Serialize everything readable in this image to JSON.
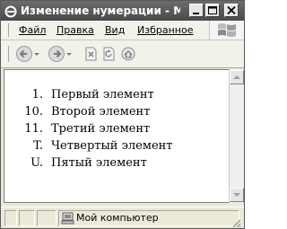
{
  "window": {
    "title": "Изменение нумерации - Microsoft Internet Explorer"
  },
  "menu": {
    "items": [
      "Файл",
      "Правка",
      "Вид",
      "Избранное"
    ]
  },
  "toolbar": {
    "buttons": [
      "back",
      "forward",
      "stop",
      "refresh",
      "home"
    ]
  },
  "page": {
    "list": [
      {
        "marker": "1.",
        "text": "Первый элемент"
      },
      {
        "marker": "10.",
        "text": "Второй элемент"
      },
      {
        "marker": "11.",
        "text": "Третий элемент"
      },
      {
        "marker": "T.",
        "text": "Четвертый элемент"
      },
      {
        "marker": "U.",
        "text": "Пятый элемент"
      }
    ]
  },
  "status": {
    "zone": "Мой компьютер"
  },
  "icons": {
    "app": "ie-icon",
    "logo": "windows-logo-icon",
    "zone": "my-computer-icon"
  },
  "colors": {
    "titlebar": "#5a5a5a",
    "chrome": "#ece9d8",
    "content": "#ffffff"
  }
}
